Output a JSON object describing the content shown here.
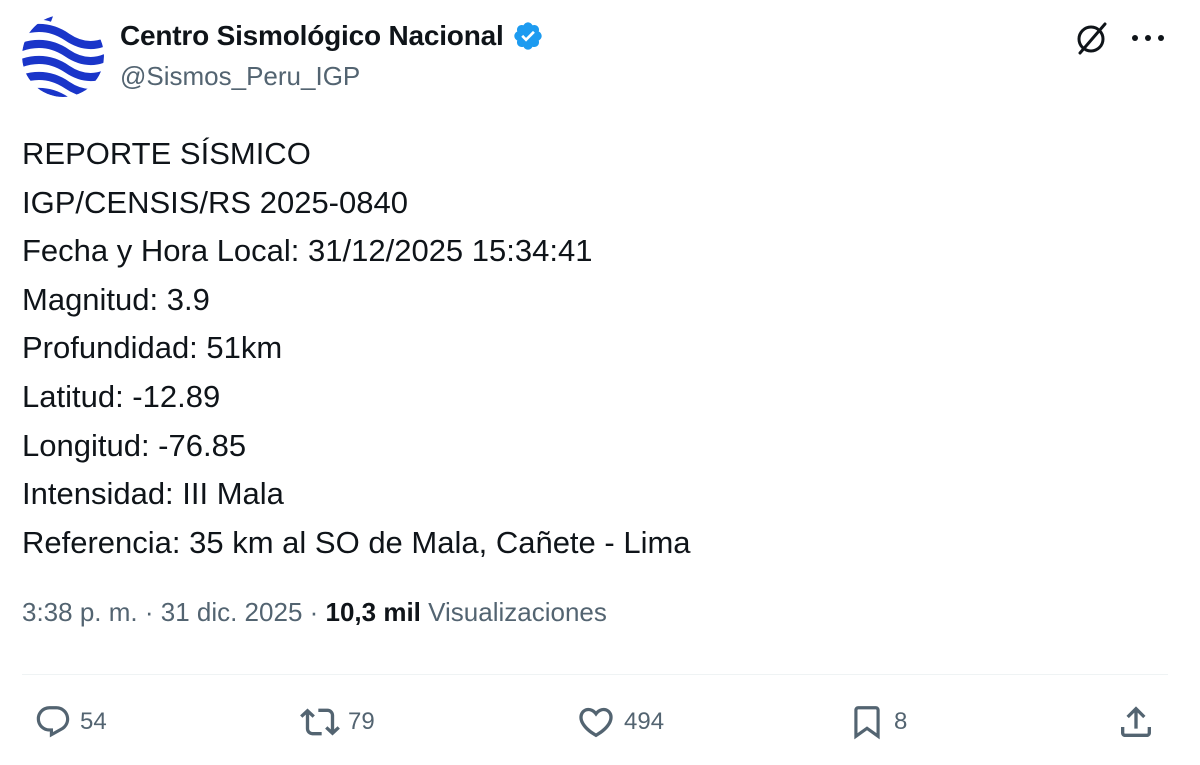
{
  "author": {
    "name": "Centro Sismológico Nacional",
    "handle": "@Sismos_Peru_IGP",
    "avatar": "igp-wave-logo",
    "verified_icon": "verified-badge-icon"
  },
  "header_actions": {
    "grok_icon": "grok-slash-icon",
    "more_icon": "more-dots-icon",
    "more_label": "···"
  },
  "tweet": {
    "lines": [
      "REPORTE SÍSMICO",
      "IGP/CENSIS/RS 2025-0840",
      "Fecha y Hora Local: 31/12/2025 15:34:41",
      "Magnitud: 3.9",
      "Profundidad: 51km",
      "Latitud: -12.89",
      "Longitud: -76.85",
      "Intensidad: III Mala",
      "Referencia: 35 km al SO de Mala, Cañete - Lima"
    ]
  },
  "meta": {
    "time": "3:38 p. m.",
    "separator": " · ",
    "date": "31 dic. 2025",
    "views_count": "10,3 mil",
    "views_label": " Visualizaciones"
  },
  "actions": {
    "reply": {
      "icon": "reply-icon",
      "count": "54"
    },
    "retweet": {
      "icon": "retweet-icon",
      "count": "79"
    },
    "like": {
      "icon": "heart-icon",
      "count": "494"
    },
    "bookmark": {
      "icon": "bookmark-icon",
      "count": "8"
    },
    "share": {
      "icon": "share-icon"
    }
  },
  "colors": {
    "text": "#0f1419",
    "secondary": "#536471",
    "verified": "#1d9bf0",
    "avatar_blue": "#1a35c9",
    "divider": "#eff3f4"
  }
}
